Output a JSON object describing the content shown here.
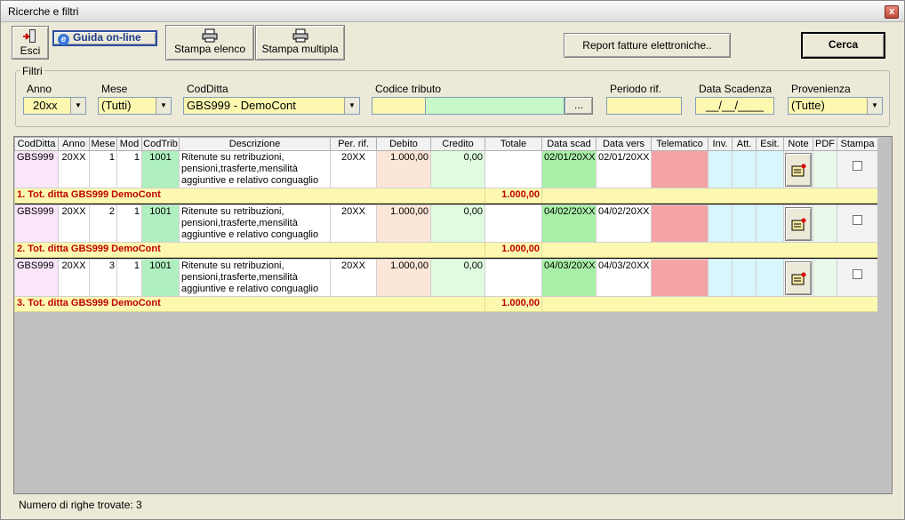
{
  "window": {
    "title": "Ricerche e filtri",
    "close_symbol": "x"
  },
  "toolbar": {
    "esci": "Esci",
    "guida": "Guida on-line",
    "guida_icon": "e",
    "stampa_elenco": "Stampa elenco",
    "stampa_multipla": "Stampa multipla",
    "report": "Report fatture elettroniche..",
    "cerca": "Cerca"
  },
  "filters": {
    "legend": "Filtri",
    "anno": {
      "label": "Anno",
      "value": "20xx"
    },
    "mese": {
      "label": "Mese",
      "value": "(Tutti)"
    },
    "codditta": {
      "label": "CodDitta",
      "value": "GBS999 - DemoCont"
    },
    "codice_tributo": {
      "label": "Codice tributo",
      "value": "",
      "browse": "..."
    },
    "periodo_rif": {
      "label": "Periodo rif.",
      "value": ""
    },
    "data_scadenza": {
      "label": "Data Scadenza",
      "value": "__/__/____"
    },
    "provenienza": {
      "label": "Provenienza",
      "value": "(Tutte)"
    }
  },
  "table": {
    "headers": [
      "CodDitta",
      "Anno",
      "Mese",
      "Mod",
      "CodTrib",
      "Descrizione",
      "Per. rif.",
      "Debito",
      "Credito",
      "Totale",
      "Data scad",
      "Data vers",
      "Telematico",
      "Inv.",
      "Att.",
      "Esit.",
      "Note",
      "PDF",
      "Stampa"
    ],
    "rows": [
      {
        "codditta": "GBS999",
        "anno": "20XX",
        "mese": "1",
        "mod": "1",
        "codtrib": "1001",
        "descrizione": "Ritenute su retribuzioni, pensioni,trasferte,mensilità aggiuntive e relativo conguaglio",
        "per_rif": "20XX",
        "debito": "1.000,00",
        "credito": "0,00",
        "data_scad": "02/01/20XX",
        "data_vers": "02/01/20XX",
        "total_label": "1. Tot. ditta GBS999 DemoCont",
        "total_value": "1.000,00"
      },
      {
        "codditta": "GBS999",
        "anno": "20XX",
        "mese": "2",
        "mod": "1",
        "codtrib": "1001",
        "descrizione": "Ritenute su retribuzioni, pensioni,trasferte,mensilità aggiuntive e relativo conguaglio",
        "per_rif": "20XX",
        "debito": "1.000,00",
        "credito": "0,00",
        "data_scad": "04/02/20XX",
        "data_vers": "04/02/20XX",
        "total_label": "2. Tot. ditta GBS999 DemoCont",
        "total_value": "1.000,00"
      },
      {
        "codditta": "GBS999",
        "anno": "20XX",
        "mese": "3",
        "mod": "1",
        "codtrib": "1001",
        "descrizione": "Ritenute su retribuzioni, pensioni,trasferte,mensilità aggiuntive e relativo conguaglio",
        "per_rif": "20XX",
        "debito": "1.000,00",
        "credito": "0,00",
        "data_scad": "04/03/20XX",
        "data_vers": "04/03/20XX",
        "total_label": "3. Tot. ditta GBS999 DemoCont",
        "total_value": "1.000,00"
      }
    ]
  },
  "status": {
    "text": "Numero di righe trovate: 3"
  }
}
